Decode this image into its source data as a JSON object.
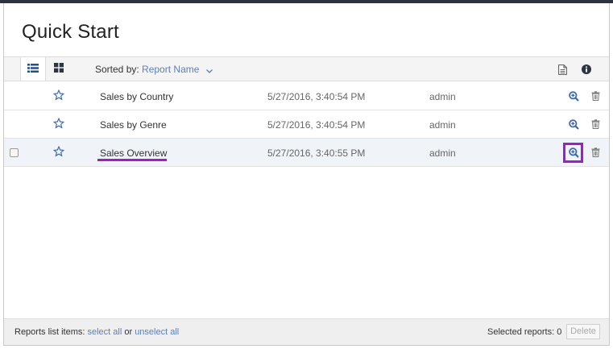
{
  "header": {
    "title": "Quick Start"
  },
  "toolbar": {
    "sort_prefix": "Sorted by:",
    "sort_value": "Report Name"
  },
  "reports": [
    {
      "name": "Sales by Country",
      "date": "5/27/2016, 3:40:54 PM",
      "owner": "admin"
    },
    {
      "name": "Sales by Genre",
      "date": "5/27/2016, 3:40:54 PM",
      "owner": "admin"
    },
    {
      "name": "Sales Overview",
      "date": "5/27/2016, 3:40:55 PM",
      "owner": "admin"
    }
  ],
  "footer": {
    "items_prefix": "Reports list items:",
    "select_all": "select all",
    "or": "or",
    "unselect_all": "unselect all",
    "selected_reports_label": "Selected reports:",
    "selected_reports_count": "0",
    "delete_label": "Delete"
  },
  "colors": {
    "accent": "#5d7fb8",
    "highlight": "#9b1fd1",
    "icon": "#3d6aa8"
  },
  "icons": {
    "view_list": "list-view-icon",
    "view_grid": "grid-view-icon",
    "sort": "chevron-down-icon",
    "doc": "document-icon",
    "info": "info-icon",
    "star": "star-outline-icon",
    "view_report": "zoom-in-icon",
    "delete": "trash-icon"
  }
}
